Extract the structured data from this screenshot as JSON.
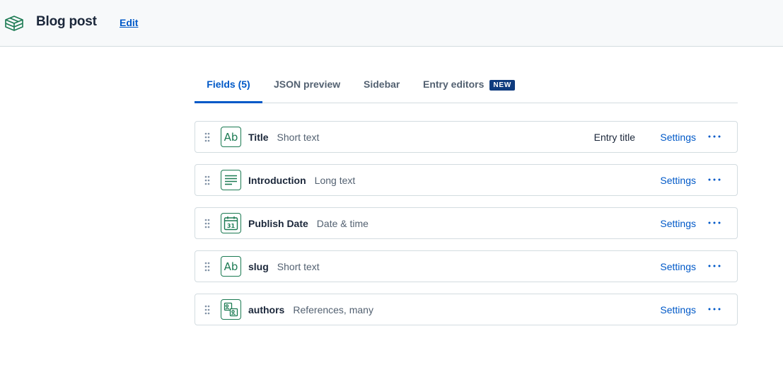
{
  "header": {
    "logo_icon": "content-model-cube-icon",
    "title": "Blog post",
    "edit_label": "Edit"
  },
  "tabs": [
    {
      "label": "Fields (5)",
      "active": true
    },
    {
      "label": "JSON preview",
      "active": false
    },
    {
      "label": "Sidebar",
      "active": false
    },
    {
      "label": "Entry editors",
      "active": false,
      "badge": "NEW"
    }
  ],
  "fields": [
    {
      "name": "Title",
      "type": "Short text",
      "icon": "short-text-icon",
      "tag": "Entry title",
      "settings_label": "Settings"
    },
    {
      "name": "Introduction",
      "type": "Long text",
      "icon": "long-text-icon",
      "settings_label": "Settings"
    },
    {
      "name": "Publish Date",
      "type": "Date & time",
      "icon": "calendar-icon",
      "icon_text": "31",
      "settings_label": "Settings"
    },
    {
      "name": "slug",
      "type": "Short text",
      "icon": "short-text-icon",
      "settings_label": "Settings"
    },
    {
      "name": "authors",
      "type": "References, many",
      "icon": "references-icon",
      "settings_label": "Settings"
    }
  ],
  "short_text_glyph": "Ab",
  "colors": {
    "accent": "#0059c8",
    "field_icon": "#1b7a52",
    "badge_bg": "#0e3b7e",
    "header_bg": "#f7f9fa"
  }
}
